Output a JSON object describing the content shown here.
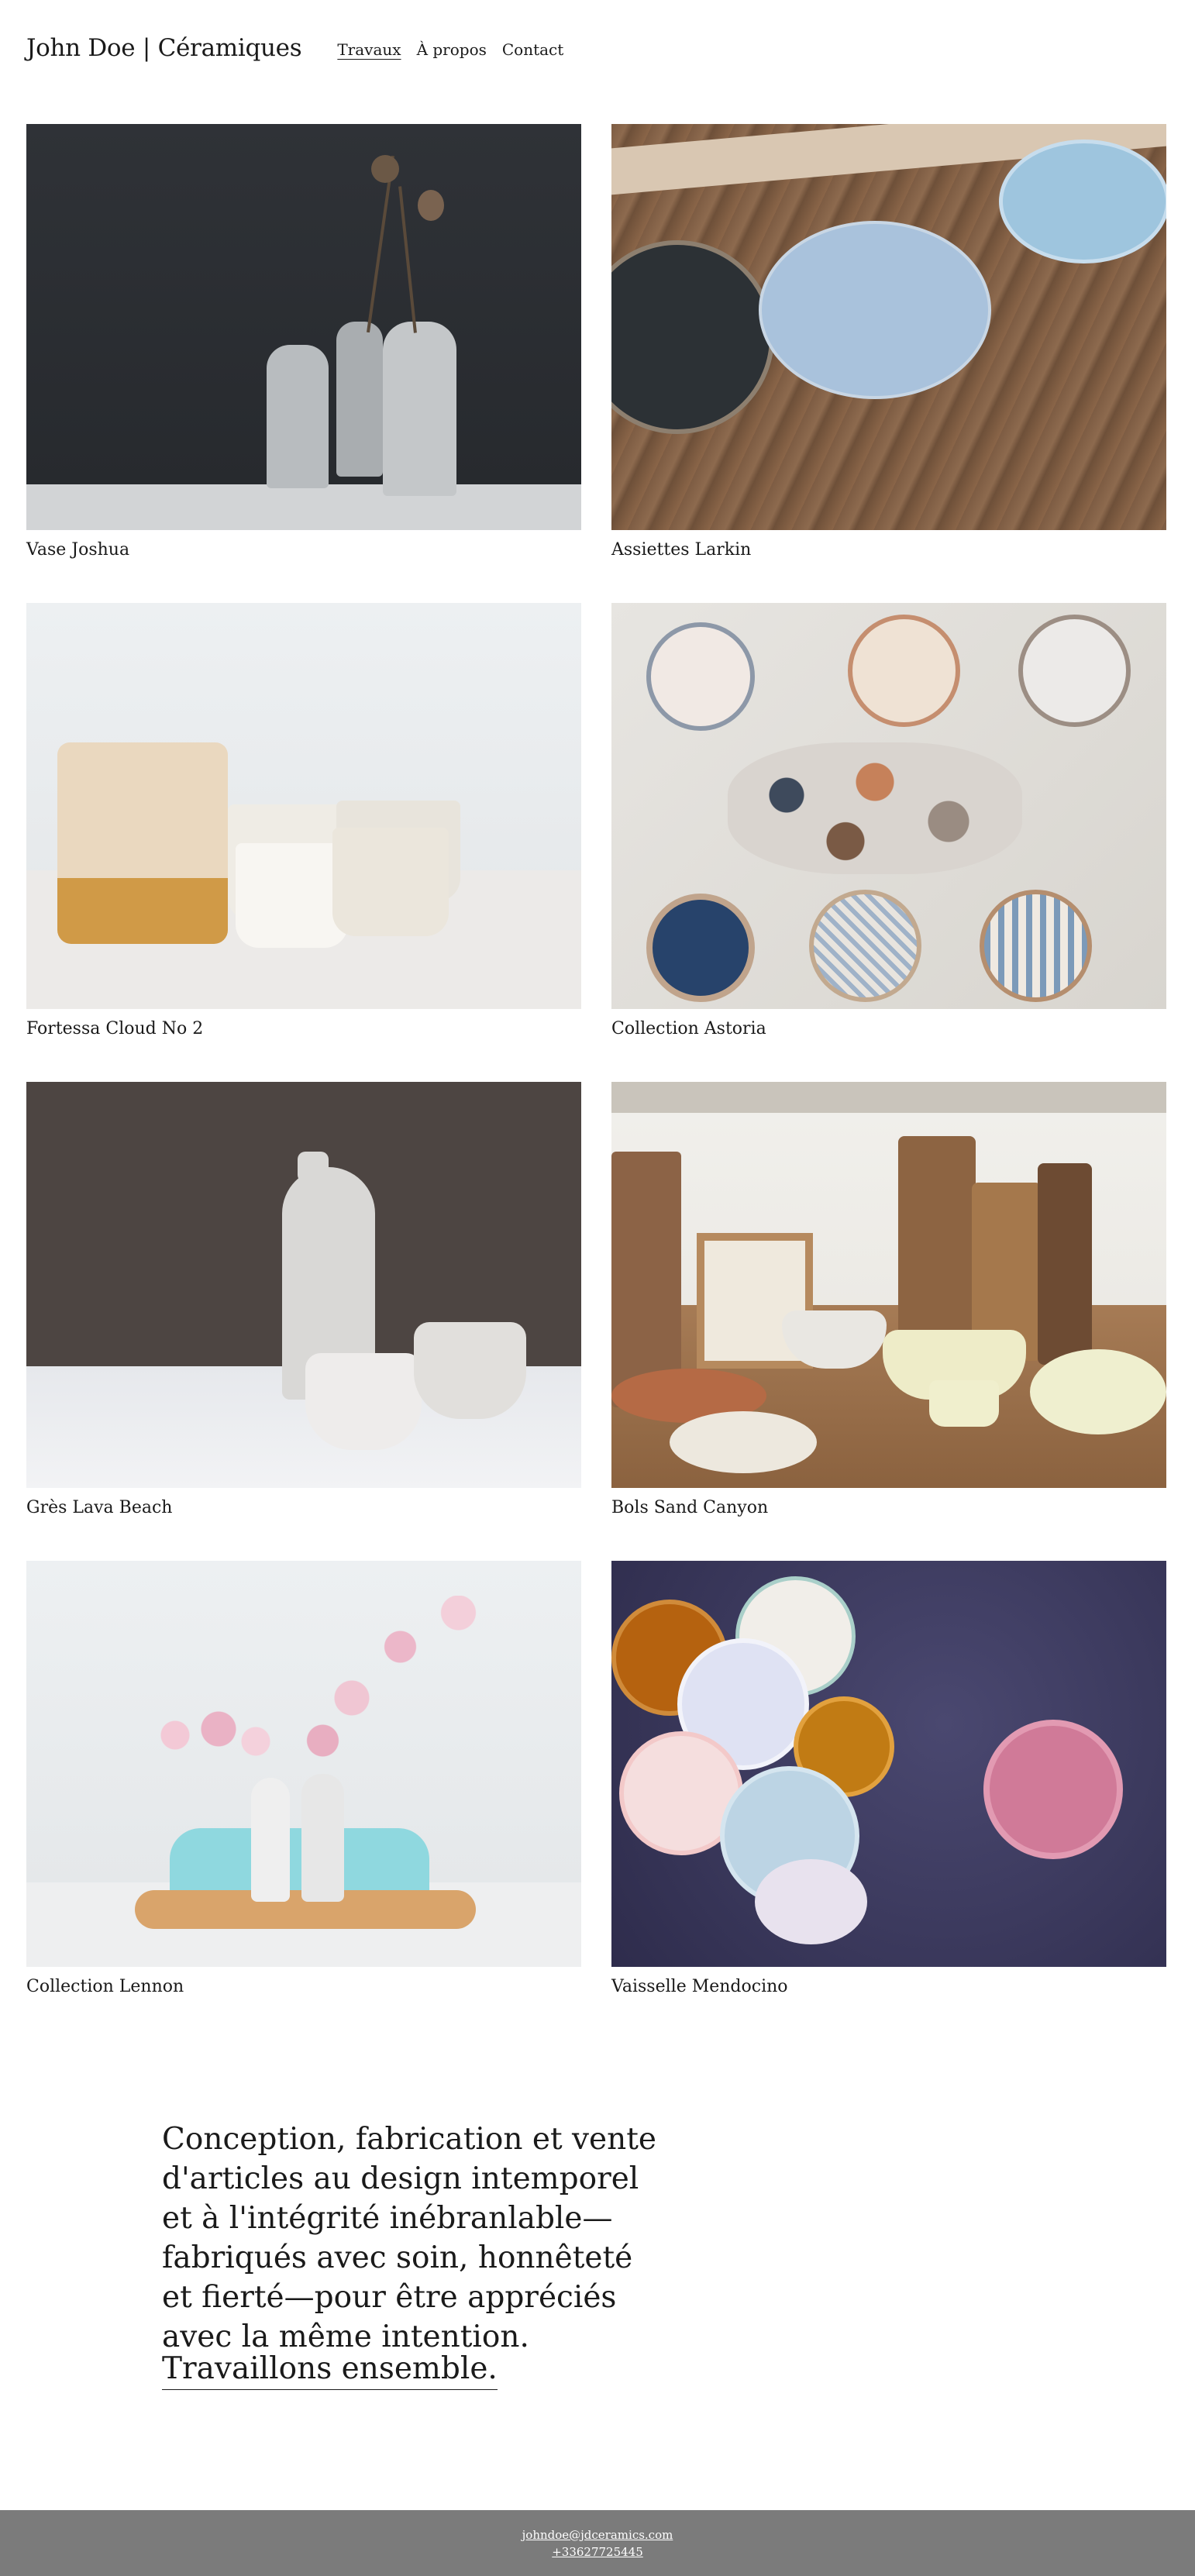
{
  "site": {
    "title": "John Doe | Céramiques"
  },
  "nav": {
    "items": [
      "Travaux",
      "À propos",
      "Contact"
    ],
    "active": "Travaux"
  },
  "works": [
    {
      "title": "Vase Joshua"
    },
    {
      "title": "Assiettes Larkin"
    },
    {
      "title": "Fortessa Cloud No 2"
    },
    {
      "title": "Collection Astoria"
    },
    {
      "title": "Grès Lava Beach"
    },
    {
      "title": "Bols Sand Canyon"
    },
    {
      "title": "Collection Lennon"
    },
    {
      "title": "Vaisselle Mendocino"
    }
  ],
  "tagline": "Conception, fabrication et vente d'articles au design intemporel et à l'intégrité inébranlable—fabriqués avec soin, honnêteté et fierté—pour être appréciés avec la même intention.",
  "cta": "Travaillons ensemble.",
  "footer": {
    "email": "johndoe@jdceramics.com",
    "phone": "+33627725445"
  }
}
